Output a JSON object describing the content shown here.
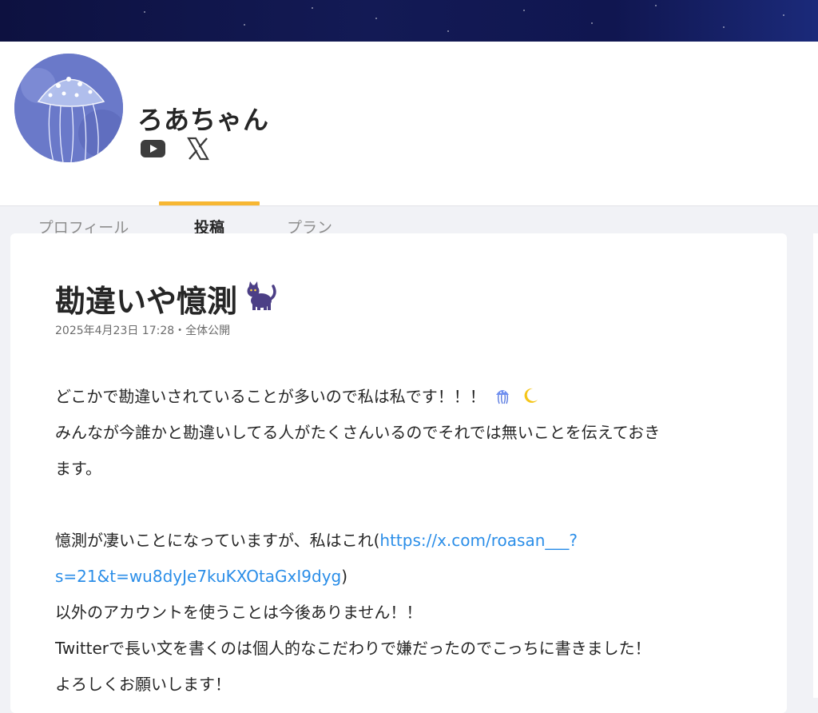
{
  "creator": {
    "name": "ろあちゃん",
    "social_icons": [
      "youtube-icon",
      "x-icon"
    ]
  },
  "tabs": [
    {
      "label": "プロフィール",
      "active": false
    },
    {
      "label": "投稿",
      "active": true
    },
    {
      "label": "プラン",
      "active": false
    }
  ],
  "post": {
    "title": "勘違いや憶測",
    "title_emoji": "black-cat-emoji",
    "meta": "2025年4月23日 17:28・全体公開",
    "body": {
      "line1_text": "どこかで勘違いされていることが多いので私は私です！！！",
      "line1_emojis": [
        "jellyfish-emoji",
        "crescent-moon-emoji"
      ],
      "line2": "みんなが今誰かと勘違いしてる人がたくさんいるのでそれでは無いことを伝えておき",
      "line3": "ます。",
      "line4_prefix": "憶測が凄いことになっていますが、私はこれ(",
      "link_part1": "https://x.com/roasan___?",
      "link_part2": "s=21&t=wu8dyJe7kuKXOtaGxI9dyg",
      "line5_suffix": ")",
      "line6": "以外のアカウントを使うことは今後ありません！！",
      "line7": "Twitterで長い文を書くのは個人的なこだわりで嫌だったのでこっちに書きました！",
      "line8": "よろしくお願いします！"
    }
  },
  "colors": {
    "accent_tab": "#f7b733",
    "link": "#2b8ee8",
    "banner": "#131a55"
  }
}
